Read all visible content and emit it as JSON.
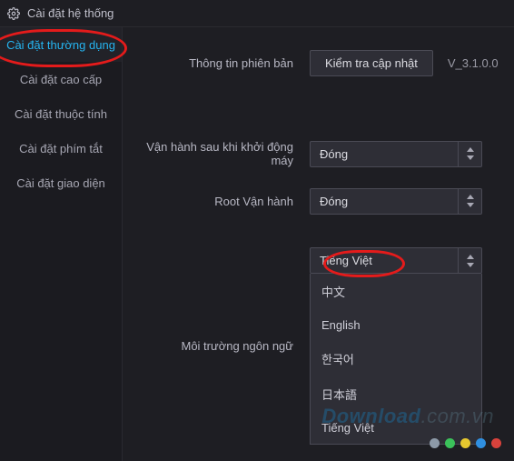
{
  "titlebar": {
    "title": "Cài đặt hệ thống"
  },
  "sidebar": {
    "items": [
      {
        "label": "Cài đặt thường dụng",
        "active": true
      },
      {
        "label": "Cài đặt cao cấp"
      },
      {
        "label": "Cài đặt thuộc tính"
      },
      {
        "label": "Cài đặt phím tắt"
      },
      {
        "label": "Cài đặt giao diện"
      }
    ]
  },
  "content": {
    "version_label": "Thông tin phiên bản",
    "update_button": "Kiểm tra cập nhật",
    "version_value": "V_3.1.0.0",
    "startup_label": "Vận hành sau khi khởi động máy",
    "startup_value": "Đóng",
    "root_label": "Root Vận hành",
    "root_value": "Đóng",
    "lang_label": "Môi trường ngôn ngữ",
    "lang_value": "Tiếng Việt",
    "lang_options": [
      {
        "label": "中文"
      },
      {
        "label": "English"
      },
      {
        "label": "한국어"
      },
      {
        "label": "日本語"
      },
      {
        "label": "Tiếng Việt"
      }
    ]
  },
  "watermark": {
    "part1": "Download",
    "part2": ".com.vn"
  },
  "dots": [
    "#8d9aa8",
    "#3bc15a",
    "#e6c82f",
    "#2f8fe0",
    "#d8423c"
  ]
}
